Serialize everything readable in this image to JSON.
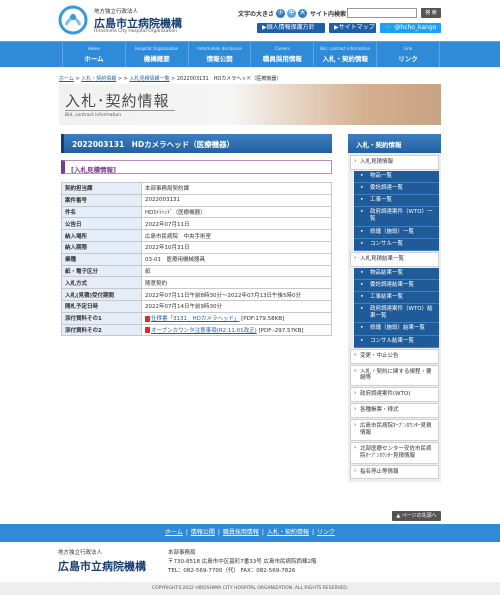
{
  "header": {
    "org_sub": "地方独立行政法人",
    "org_name": "広島市立病院機構",
    "org_en": "Hiroshima City Hospital Organization",
    "font_size_label": "文字の大きさ",
    "font_small": "小",
    "font_mid": "中",
    "font_large": "大",
    "site_search_label": "サイト内検索",
    "search_value": "",
    "search_button": "検 索",
    "privacy_button": "▶個人情報保護方針",
    "sitemap_button": "▶サイトマップ",
    "twitter_button": "@hcho_kango"
  },
  "gnav": [
    {
      "en": "Home",
      "jp": "ホーム"
    },
    {
      "en": "Hospital Organization",
      "jp": "機構概要"
    },
    {
      "en": "Information disclosure",
      "jp": "情報公開"
    },
    {
      "en": "Careers",
      "jp": "職員採用情報"
    },
    {
      "en": "Bid, contract information",
      "jp": "入札・契約情報"
    },
    {
      "en": "Link",
      "jp": "リンク"
    }
  ],
  "breadcrumb": {
    "home": "ホーム",
    "sep": ">",
    "c1": "入札・契約情報",
    "c2": "入札見積情報一覧",
    "current": "2022003131　HDカメラヘッド（医療機器）"
  },
  "banner": {
    "title": "入札･契約情報",
    "en": "Bid, contract information"
  },
  "case": {
    "title": "2022003131　HDカメラヘッド（医療機器）",
    "section": "[入札見積情報]",
    "rows": [
      {
        "k": "契約担当課",
        "v": "本部事務局契約課"
      },
      {
        "k": "案件番号",
        "v": "2022003131"
      },
      {
        "k": "件名",
        "v": "HDｶﾒﾗﾍｯﾄﾞ（医療機器）"
      },
      {
        "k": "公告日",
        "v": "2022年07月11日"
      },
      {
        "k": "納入場所",
        "v": "広島市民病院　中央手術室"
      },
      {
        "k": "納入期限",
        "v": "2022年10月31日"
      },
      {
        "k": "業種",
        "v": "03-01　医療用機械器具"
      },
      {
        "k": "紙・電子区分",
        "v": "紙"
      },
      {
        "k": "入札方式",
        "v": "随意契約"
      },
      {
        "k": "入札(見積)受付期間",
        "v": "2022年07月11日午前8時30分～2022年07月13日午後5時0分"
      },
      {
        "k": "開札予定日時",
        "v": "2022年07月14日午前9時30分"
      }
    ],
    "attach1": {
      "k": "添付資料その1",
      "link": "仕様書「3131　HDカメラヘッド」",
      "size": "[PDF:179.58KB]"
    },
    "attach2": {
      "k": "添付資料その2",
      "link": "オープンカウンタ注意事項(R2.11.01改正)",
      "size": "[PDF:-297.57KB]"
    }
  },
  "sidebar": {
    "head": "入札・契約情報",
    "group1": {
      "title": "入札見積情報",
      "items": [
        "物品一覧",
        "委託調達一覧",
        "工事一覧",
        "政府調達案件（WTO）一覧",
        "修繕（施設）一覧",
        "コンサル一覧"
      ]
    },
    "group2": {
      "title": "入札見積結果一覧",
      "items": [
        "物品結果一覧",
        "委託調達結果一覧",
        "工事結果一覧",
        "政府調達案件（WTO）結果一覧",
        "修繕（施設）結果一覧",
        "コンサル結果一覧"
      ]
    },
    "tail": [
      "変更・中止公告",
      "入札・契約に関する規程・要綱等",
      "政府調達案件(WTO)",
      "各種帳票・様式",
      "広島市民病院ｵｰﾌﾟﾝｶｳﾝﾀｰ見積情報",
      "北部医療センター安佐市民病院ｵｰﾌﾟﾝｶｳﾝﾀｰ見積情報",
      "指名停止等情報"
    ]
  },
  "pagetop": "▲ ページの先頭へ",
  "footer": {
    "nav": [
      "ホーム",
      "情報公開",
      "職員採用情報",
      "入札・契約情報",
      "リンク"
    ],
    "sep": "|",
    "org_sub": "地方独立行政法人",
    "org_name": "広島市立病院機構",
    "addr1": "本部事務局",
    "addr2": "〒730-8518 広島市中区基町7番33号 広島市民病院西棟2階",
    "addr3": "TEL：082-569-7700（代）  FAX：082-569-7826",
    "copyright": "COPYRIGHT©2022 HIROSHIMA CITY HOSPITAL ORGANIZATION. ALL RIGHTS RESERVED."
  },
  "colors": {
    "brand_navy": "#1a3f74",
    "nav_blue": "#2f8ad8",
    "header_blue": "#225f9e",
    "section_purple": "#7b3d8f",
    "pdf_red": "#d32f2f"
  }
}
